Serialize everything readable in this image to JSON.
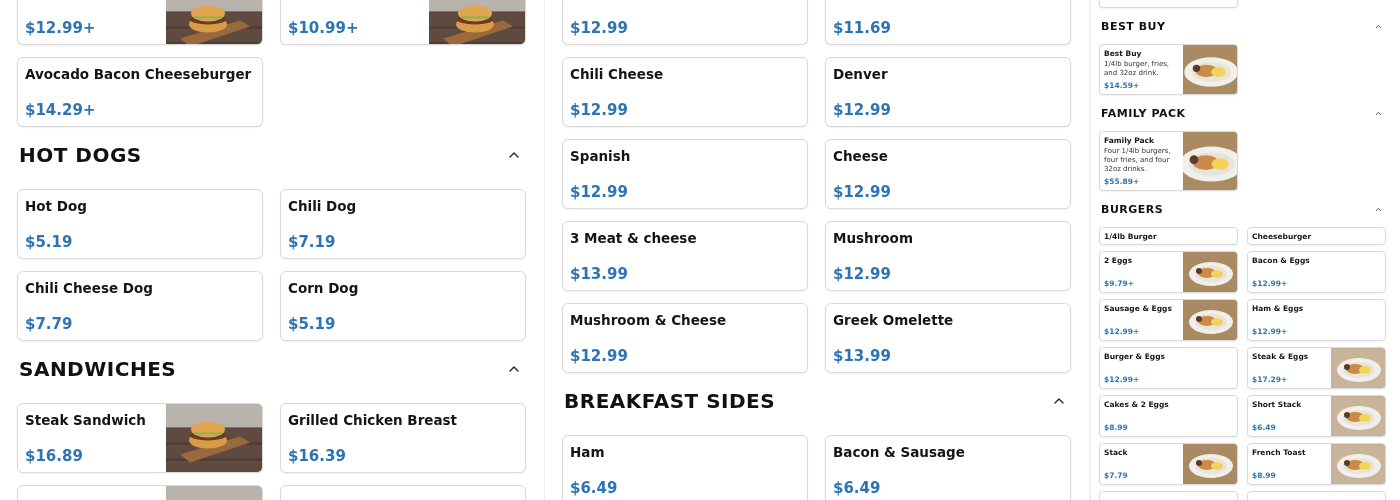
{
  "panes": [
    {
      "kind": "wide",
      "blocks": [
        {
          "kind": "cards",
          "items": [
            {
              "price": "$12.99+",
              "photo": true
            },
            {
              "price": "$10.99+",
              "photo": true
            }
          ]
        },
        {
          "kind": "grid",
          "items": [
            {
              "name": "Avocado Bacon Cheeseburger",
              "price": "$14.29+",
              "photo": false
            }
          ]
        },
        {
          "kind": "section",
          "title": "HOT DOGS",
          "expanded": true,
          "items": [
            {
              "name": "Hot Dog",
              "price": "$5.19",
              "photo": false
            },
            {
              "name": "Chili Dog",
              "price": "$7.19",
              "photo": false
            },
            {
              "name": "Chili Cheese Dog",
              "price": "$7.79",
              "photo": false
            },
            {
              "name": "Corn Dog",
              "price": "$5.19",
              "photo": false
            }
          ]
        },
        {
          "kind": "section",
          "title": "SANDWICHES",
          "expanded": true,
          "items": [
            {
              "name": "Steak Sandwich",
              "price": "$16.89",
              "photo": true
            },
            {
              "name": "Grilled Chicken Breast",
              "price": "$16.39",
              "photo": false
            },
            {
              "photo": true
            },
            {
              "photo": false
            }
          ]
        }
      ]
    },
    {
      "kind": "wide",
      "blocks": [
        {
          "kind": "cards",
          "items": [
            {
              "price": "$12.99",
              "photo": false
            },
            {
              "price": "$11.69",
              "photo": false
            }
          ]
        },
        {
          "kind": "grid",
          "items": [
            {
              "name": "Chili Cheese",
              "price": "$12.99",
              "photo": false
            },
            {
              "name": "Denver",
              "price": "$12.99",
              "photo": false
            },
            {
              "name": "Spanish",
              "price": "$12.99",
              "photo": false
            },
            {
              "name": "Cheese",
              "price": "$12.99",
              "photo": false
            },
            {
              "name": "3 Meat & cheese",
              "price": "$13.99",
              "photo": false
            },
            {
              "name": "Mushroom",
              "price": "$12.99",
              "photo": false
            },
            {
              "name": "Mushroom & Cheese",
              "price": "$12.99",
              "photo": false
            },
            {
              "name": "Greek Omelette",
              "price": "$13.99",
              "photo": false
            }
          ]
        },
        {
          "kind": "section",
          "title": "BREAKFAST SIDES",
          "expanded": true,
          "items": [
            {
              "name": "Ham",
              "price": "$6.49",
              "photo": false
            },
            {
              "name": "Bacon & Sausage",
              "price": "$6.49",
              "photo": false
            }
          ]
        }
      ]
    },
    {
      "kind": "compact",
      "blocks": [
        {
          "kind": "cards",
          "items": [
            {
              "photo": false
            }
          ]
        },
        {
          "kind": "section",
          "title": "BEST BUY",
          "expanded": true,
          "items": [
            {
              "name": "Best Buy",
              "description": "1/4lb burger, fries, and 32oz drink.",
              "price": "$14.59+",
              "photo": true
            }
          ]
        },
        {
          "kind": "section",
          "title": "FAMILY PACK",
          "expanded": true,
          "items": [
            {
              "name": "Family Pack",
              "description": "Four 1/4lb burgers, four fries, and four 32oz drinks.",
              "price": "$55.89+",
              "photo": true
            }
          ]
        },
        {
          "kind": "section",
          "title": "BURGERS",
          "expanded": true,
          "items": [
            {
              "name": "1/4lb Burger",
              "photo": false
            },
            {
              "name": "Cheeseburger",
              "photo": false
            },
            {
              "name": "2 Eggs",
              "price": "$9.79+",
              "photo": true
            },
            {
              "name": "Bacon & Eggs",
              "price": "$12.99+",
              "photo": false
            },
            {
              "name": "Sausage & Eggs",
              "price": "$12.99+",
              "photo": true
            },
            {
              "name": "Ham & Eggs",
              "price": "$12.99+",
              "photo": false
            },
            {
              "name": "Burger & Eggs",
              "price": "$12.99+",
              "photo": false
            },
            {
              "name": "Steak & Eggs",
              "price": "$17.29+",
              "photo": true
            },
            {
              "name": "Cakes & 2 Eggs",
              "price": "$8.99",
              "photo": false
            },
            {
              "name": "Short Stack",
              "price": "$6.49",
              "photo": true
            },
            {
              "name": "Stack",
              "price": "$7.79",
              "photo": true
            },
            {
              "name": "French Toast",
              "price": "$8.99",
              "photo": true
            },
            {
              "photo": false
            },
            {
              "photo": false
            }
          ]
        }
      ]
    }
  ]
}
